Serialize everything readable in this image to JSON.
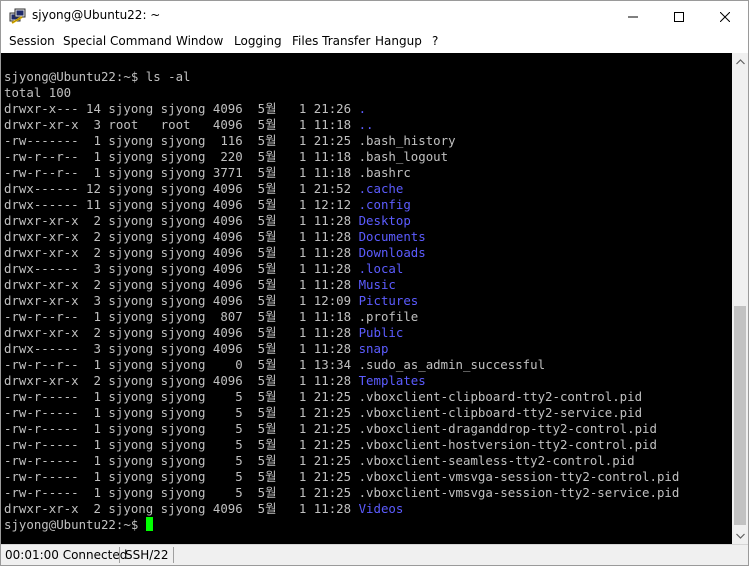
{
  "window": {
    "title": "sjyong@Ubuntu22: ~"
  },
  "menu": [
    {
      "label": "Session",
      "name": "menu-session"
    },
    {
      "label": "Special Command",
      "name": "menu-special-command"
    },
    {
      "label": "Window",
      "name": "menu-window"
    },
    {
      "label": "Logging",
      "name": "menu-logging"
    },
    {
      "label": "Files Transfer",
      "name": "menu-files-transfer"
    },
    {
      "label": "Hangup",
      "name": "menu-hangup"
    },
    {
      "label": "?",
      "name": "menu-help"
    }
  ],
  "terminal": {
    "command_line": "sjyong@Ubuntu22:~$ ls -al",
    "total_line": "total 100",
    "entries": [
      {
        "meta": "drwxr-x--- 14 sjyong sjyong 4096  5월   1 21:26 ",
        "name": ".",
        "type": "dir"
      },
      {
        "meta": "drwxr-xr-x  3 root   root   4096  5월   1 11:18 ",
        "name": "..",
        "type": "dir"
      },
      {
        "meta": "-rw-------  1 sjyong sjyong  116  5월   1 21:25 ",
        "name": ".bash_history",
        "type": "file"
      },
      {
        "meta": "-rw-r--r--  1 sjyong sjyong  220  5월   1 11:18 ",
        "name": ".bash_logout",
        "type": "file"
      },
      {
        "meta": "-rw-r--r--  1 sjyong sjyong 3771  5월   1 11:18 ",
        "name": ".bashrc",
        "type": "file"
      },
      {
        "meta": "drwx------ 12 sjyong sjyong 4096  5월   1 21:52 ",
        "name": ".cache",
        "type": "dir"
      },
      {
        "meta": "drwx------ 11 sjyong sjyong 4096  5월   1 12:12 ",
        "name": ".config",
        "type": "dir"
      },
      {
        "meta": "drwxr-xr-x  2 sjyong sjyong 4096  5월   1 11:28 ",
        "name": "Desktop",
        "type": "dir"
      },
      {
        "meta": "drwxr-xr-x  2 sjyong sjyong 4096  5월   1 11:28 ",
        "name": "Documents",
        "type": "dir"
      },
      {
        "meta": "drwxr-xr-x  2 sjyong sjyong 4096  5월   1 11:28 ",
        "name": "Downloads",
        "type": "dir"
      },
      {
        "meta": "drwx------  3 sjyong sjyong 4096  5월   1 11:28 ",
        "name": ".local",
        "type": "dir"
      },
      {
        "meta": "drwxr-xr-x  2 sjyong sjyong 4096  5월   1 11:28 ",
        "name": "Music",
        "type": "dir"
      },
      {
        "meta": "drwxr-xr-x  3 sjyong sjyong 4096  5월   1 12:09 ",
        "name": "Pictures",
        "type": "dir"
      },
      {
        "meta": "-rw-r--r--  1 sjyong sjyong  807  5월   1 11:18 ",
        "name": ".profile",
        "type": "file"
      },
      {
        "meta": "drwxr-xr-x  2 sjyong sjyong 4096  5월   1 11:28 ",
        "name": "Public",
        "type": "dir"
      },
      {
        "meta": "drwx------  3 sjyong sjyong 4096  5월   1 11:28 ",
        "name": "snap",
        "type": "dir"
      },
      {
        "meta": "-rw-r--r--  1 sjyong sjyong    0  5월   1 13:34 ",
        "name": ".sudo_as_admin_successful",
        "type": "file"
      },
      {
        "meta": "drwxr-xr-x  2 sjyong sjyong 4096  5월   1 11:28 ",
        "name": "Templates",
        "type": "dir"
      },
      {
        "meta": "-rw-r-----  1 sjyong sjyong    5  5월   1 21:25 ",
        "name": ".vboxclient-clipboard-tty2-control.pid",
        "type": "file"
      },
      {
        "meta": "-rw-r-----  1 sjyong sjyong    5  5월   1 21:25 ",
        "name": ".vboxclient-clipboard-tty2-service.pid",
        "type": "file"
      },
      {
        "meta": "-rw-r-----  1 sjyong sjyong    5  5월   1 21:25 ",
        "name": ".vboxclient-draganddrop-tty2-control.pid",
        "type": "file"
      },
      {
        "meta": "-rw-r-----  1 sjyong sjyong    5  5월   1 21:25 ",
        "name": ".vboxclient-hostversion-tty2-control.pid",
        "type": "file"
      },
      {
        "meta": "-rw-r-----  1 sjyong sjyong    5  5월   1 21:25 ",
        "name": ".vboxclient-seamless-tty2-control.pid",
        "type": "file"
      },
      {
        "meta": "-rw-r-----  1 sjyong sjyong    5  5월   1 21:25 ",
        "name": ".vboxclient-vmsvga-session-tty2-control.pid",
        "type": "file"
      },
      {
        "meta": "-rw-r-----  1 sjyong sjyong    5  5월   1 21:25 ",
        "name": ".vboxclient-vmsvga-session-tty2-service.pid",
        "type": "file"
      },
      {
        "meta": "drwxr-xr-x  2 sjyong sjyong 4096  5월   1 11:28 ",
        "name": "Videos",
        "type": "dir"
      }
    ],
    "final_prompt": "sjyong@Ubuntu22:~$ "
  },
  "status": {
    "connection": "00:01:00 Connected",
    "protocol": "SSH/22"
  },
  "colors": {
    "dir": "#5c5cff",
    "text": "#c0c0c0",
    "cursor": "#00ff00",
    "background": "#000000"
  }
}
